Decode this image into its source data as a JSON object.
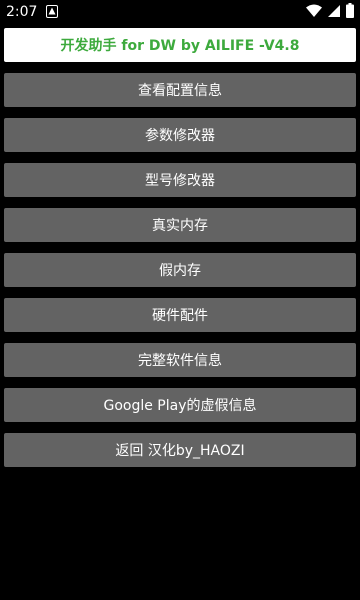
{
  "status_bar": {
    "time": "2:07",
    "notification_icon": "android-notification-icon",
    "icons": [
      "wifi-icon",
      "signal-icon",
      "battery-icon"
    ]
  },
  "header": {
    "title": "开发助手 for DW by AILIFE -V4.8",
    "title_color": "#3daa3d"
  },
  "menu": {
    "button_color": "#636363",
    "items": [
      {
        "label": "查看配置信息"
      },
      {
        "label": "参数修改器"
      },
      {
        "label": "型号修改器"
      },
      {
        "label": "真实内存"
      },
      {
        "label": "假内存"
      },
      {
        "label": "硬件配件"
      },
      {
        "label": "完整软件信息"
      },
      {
        "label": "Google Play的虚假信息"
      },
      {
        "label": "返回 汉化by_HAOZI"
      }
    ]
  }
}
